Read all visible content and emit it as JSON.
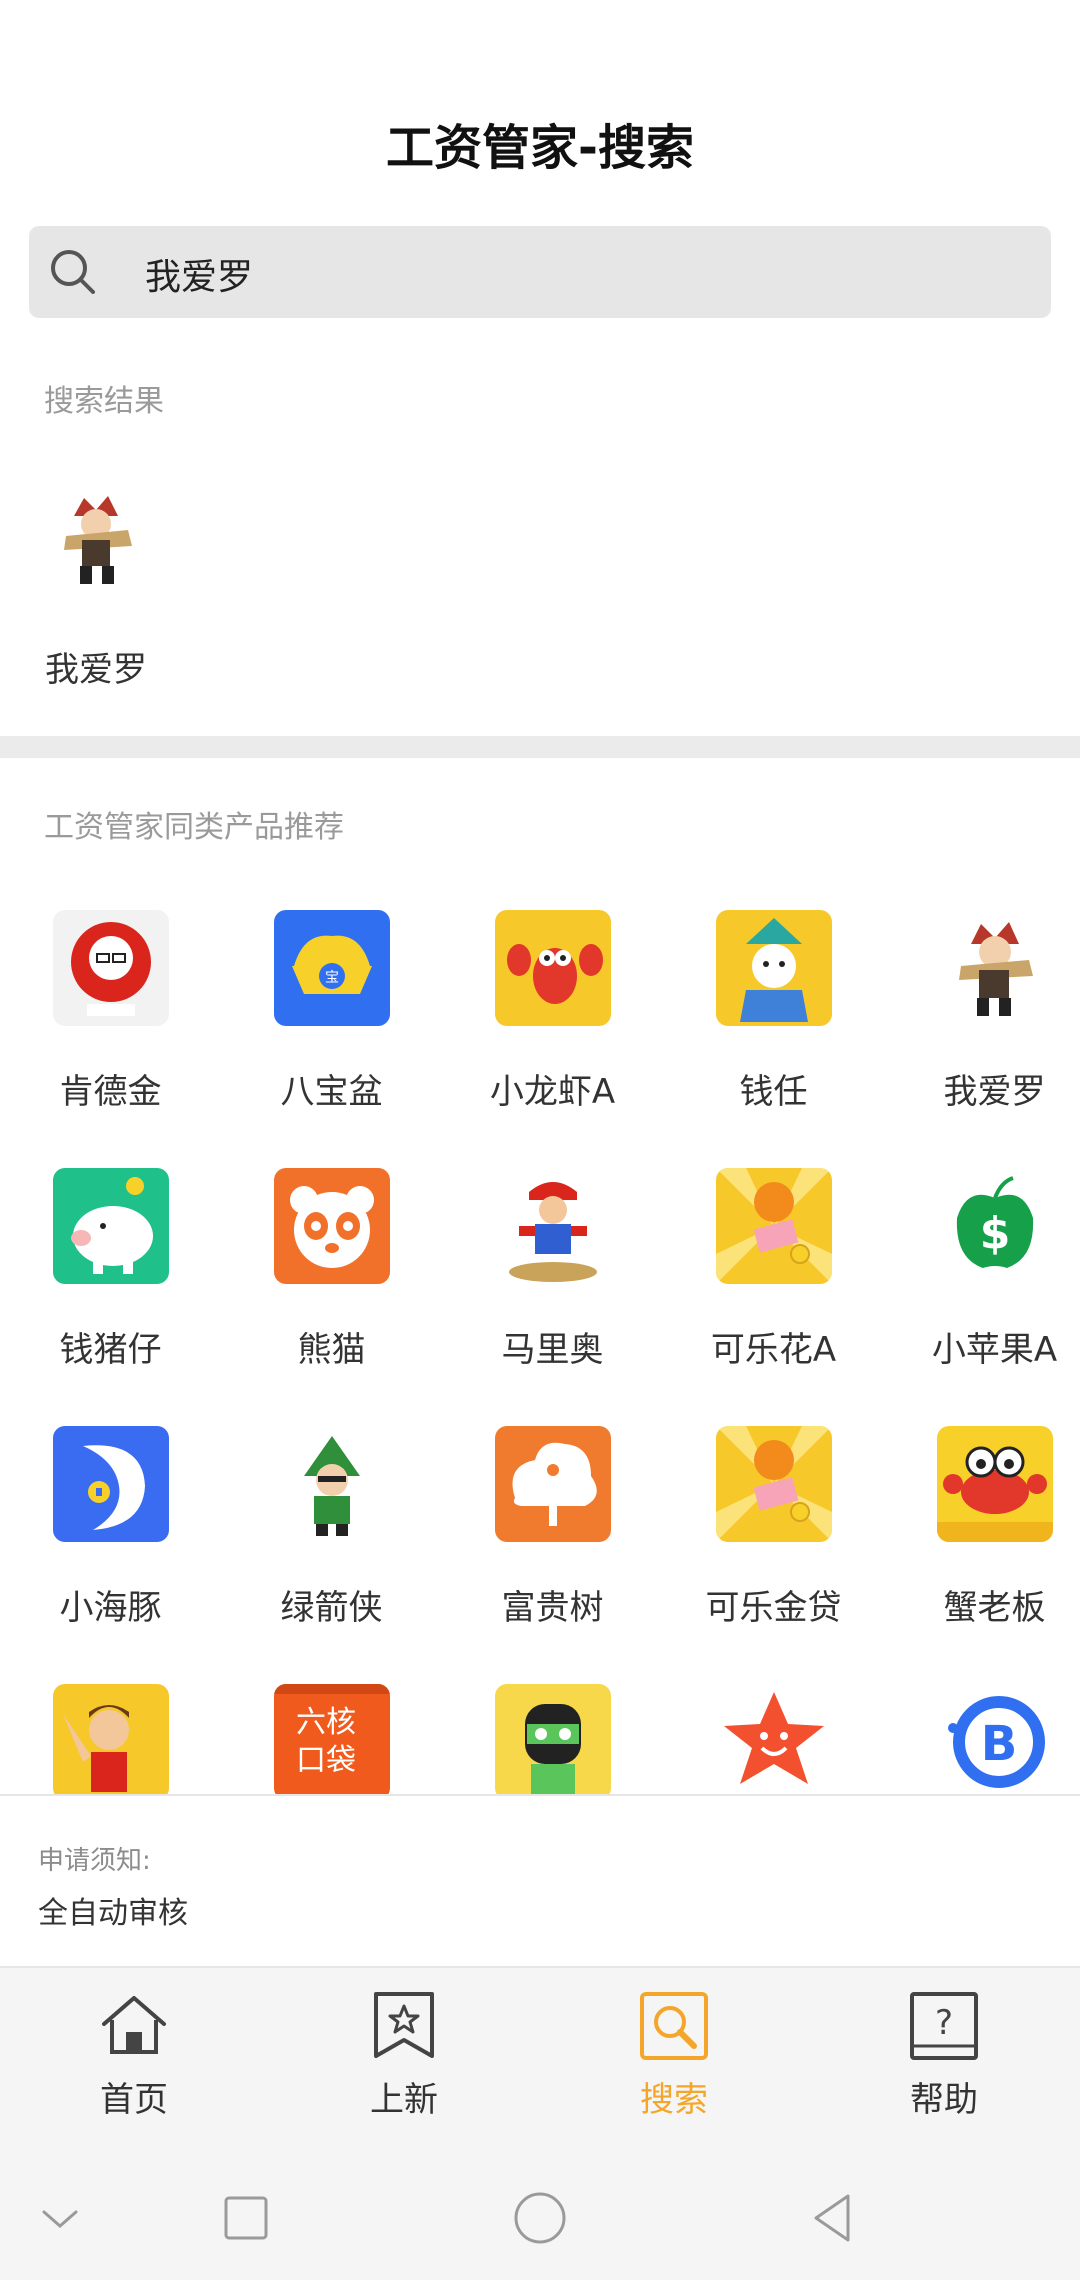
{
  "header": {
    "title": "工资管家-搜索"
  },
  "search": {
    "query": "我爱罗"
  },
  "results": {
    "section_label": "搜索结果",
    "items": [
      {
        "name": "我爱罗"
      }
    ]
  },
  "recommend": {
    "section_label": "工资管家同类产品推荐",
    "apps": [
      {
        "name": "肯德金"
      },
      {
        "name": "八宝盆"
      },
      {
        "name": "小龙虾A"
      },
      {
        "name": "钱任"
      },
      {
        "name": "我爱罗"
      },
      {
        "name": "钱猪仔"
      },
      {
        "name": "熊猫"
      },
      {
        "name": "马里奥"
      },
      {
        "name": "可乐花A"
      },
      {
        "name": "小苹果A"
      },
      {
        "name": "小海豚"
      },
      {
        "name": "绿箭侠"
      },
      {
        "name": "富贵树"
      },
      {
        "name": "可乐金贷"
      },
      {
        "name": "蟹老板"
      }
    ]
  },
  "notice": {
    "label": "申请须知:",
    "text": "全自动审核"
  },
  "tabbar": {
    "active_color": "#f4a62a",
    "items": [
      {
        "label": "首页"
      },
      {
        "label": "上新"
      },
      {
        "label": "搜索"
      },
      {
        "label": "帮助"
      }
    ]
  }
}
